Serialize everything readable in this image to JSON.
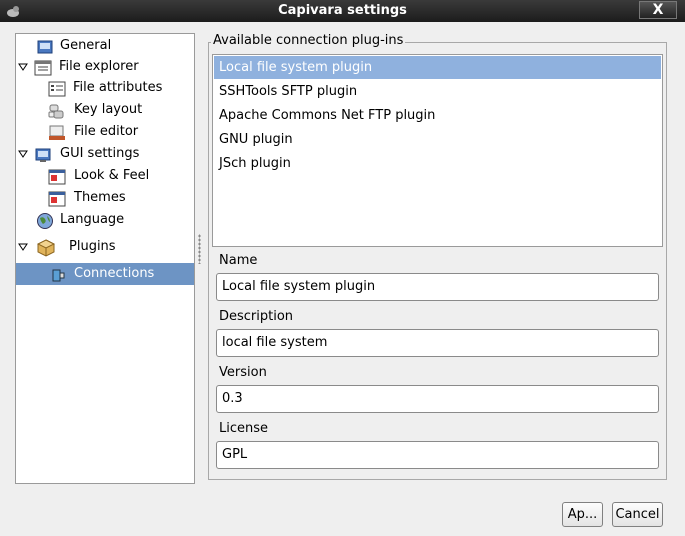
{
  "window": {
    "title": "Capivara settings",
    "close_label": "X"
  },
  "tree": {
    "items": [
      {
        "label": "General",
        "icon": "general-icon"
      },
      {
        "label": "File explorer",
        "icon": "file-explorer-icon",
        "expanded": true
      },
      {
        "label": "File attributes",
        "icon": "file-attributes-icon"
      },
      {
        "label": "Key layout",
        "icon": "key-layout-icon"
      },
      {
        "label": "File editor",
        "icon": "file-editor-icon"
      },
      {
        "label": "GUI settings",
        "icon": "gui-settings-icon",
        "expanded": true
      },
      {
        "label": "Look & Feel",
        "icon": "look-feel-icon"
      },
      {
        "label": "Themes",
        "icon": "themes-icon"
      },
      {
        "label": "Language",
        "icon": "language-icon"
      },
      {
        "label": "Plugins",
        "icon": "plugins-icon",
        "expanded": true
      },
      {
        "label": "Connections",
        "icon": "connections-icon",
        "selected": true
      }
    ]
  },
  "plugins": {
    "group_label": "Available connection plug-ins",
    "items": [
      "Local file system plugin",
      "SSHTools SFTP plugin",
      "Apache Commons Net FTP plugin",
      "GNU plugin",
      "JSch plugin"
    ],
    "selected_index": 0
  },
  "details": {
    "name_label": "Name",
    "name_value": "Local file system plugin",
    "description_label": "Description",
    "description_value": "local file system",
    "version_label": "Version",
    "version_value": "0.3",
    "license_label": "License",
    "license_value": "GPL"
  },
  "buttons": {
    "apply_label": "Ap...",
    "cancel_label": "Cancel"
  },
  "colors": {
    "selection_tree": "#6d94c4",
    "selection_list": "#8fb1de",
    "titlebar": "#2a2a2a"
  }
}
